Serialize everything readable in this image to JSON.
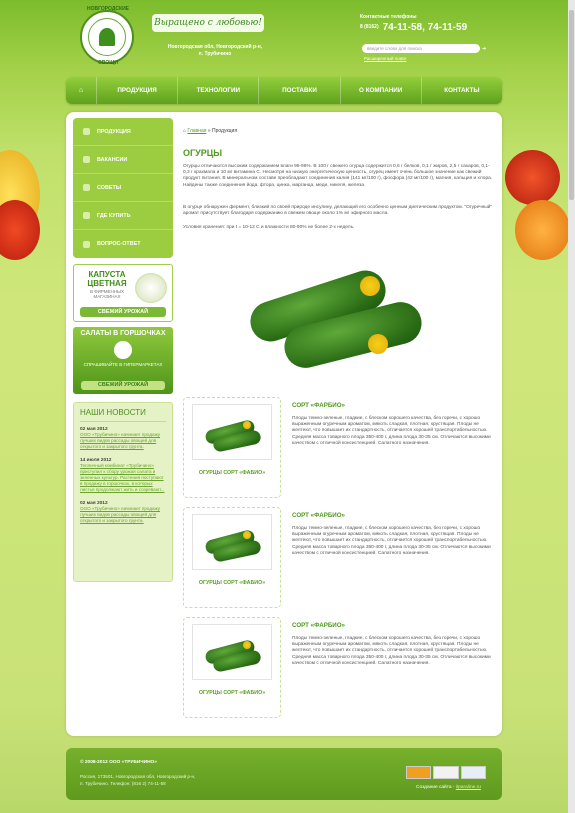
{
  "header": {
    "logo_top": "НОВГОРОДСКИЕ",
    "logo_bottom": "ОВОЩИ",
    "slogan": "Выращено с любовью!",
    "address_line1": "Новгородская обл, Новгородский р-н,",
    "address_line2": "п. Трубичино",
    "phones_label": "Контактные телефоны",
    "phone_code": "8 (8162)",
    "phones": "74-11-58, 74-11-59",
    "search_placeholder": "введите слово для поиска",
    "advanced_search": "Расширенный поиск"
  },
  "nav": {
    "home_icon": "home-icon",
    "items": [
      "ПРОДУКЦИЯ",
      "ТЕХНОЛОГИИ",
      "ПОСТАВКИ",
      "О КОМПАНИИ",
      "КОНТАКТЫ"
    ]
  },
  "sidebar": {
    "items": [
      "ПРОДУКЦИЯ",
      "ВАКАНСИИ",
      "СОВЕТЫ",
      "ГДЕ КУПИТЬ",
      "ВОПРОС-ОТВЕТ"
    ]
  },
  "banner1": {
    "title": "КАПУСТА ЦВЕТНАЯ",
    "sub": "В ФИРМЕННЫХ МАГАЗИНАХ",
    "bar": "СВЕЖИЙ УРОЖАЙ"
  },
  "banner2": {
    "title": "САЛАТЫ В ГОРШОЧКАХ",
    "sub": "СПРАШИВАЙТЕ В ГИПЕРМАРКЕТАХ",
    "bar": "СВЕЖИЙ УРОЖАЙ"
  },
  "news": {
    "title": "НАШИ НОВОСТИ",
    "items": [
      {
        "date": "02 мая 2012",
        "text": "ООО «Трубичино» начинает продажу лучших видов рассады овощей для открытого и закрытого грунта."
      },
      {
        "date": "14 июля 2012",
        "text": "Тепличный комбинат «Трубичино» приступил к сбору урожая салата и зеленных культур. Растения поступают в продажу в горшочках, в которых листья продолжают жить и созревают..."
      },
      {
        "date": "02 мая 2012",
        "text": "ООО «Трубичино» начинает продажу лучших видов рассады овощей для открытого и закрытого грунта."
      }
    ]
  },
  "breadcrumb": {
    "home": "Главная",
    "current": "Продукция"
  },
  "content": {
    "title": "ОГУРЦЫ",
    "p1": "Огурцы отличаются высоким содержанием влаги 95-96%. В 100 г свежего огурца содержится 0,6 г белков, 0,1 г жиров, 2,5 г сахаров, 0,1-0,3 г крахмала и 10 мг витамина С. Несмотря на низкую энергетическую ценность, огурец имеет очень большое значение как свежий продукт питания. В минеральном составе преобладают соединения калия (141 мг/100 г), фосфора (42 мг/100 г), магния, кальция и хлора. Найдены также соединения йода, фтора, цинка, марганца, меди, никеля, железа.",
    "p2": "В огурце обнаружен фермент, близкий по своей природе инсулину, делающий его особенно ценным диетическим продуктом. \"Огуречный\" аромат присутствует благодаря содержанию в свежем овоще около 1% мг эфирного масла.",
    "p3": "Условия хранения: при t = 10-12 С и влажности 80-90% не более 2-х недель."
  },
  "products": [
    {
      "caption": "ОГУРЦЫ СОРТ «ФАБИО»",
      "title": "СОРТ «ФАРБИО»",
      "desc": "Плоды темно-зеленые, гладкие, с блеском хорошего качества, без горечи, с хорошо выраженным огуречным ароматом, мякоть сладкая, плотная, хрустящая. Плоды не желтеют, что повышает их стандартность, отличается хорошей транспортабельностью. Средняя масса товарного плода 350-400 г, длина плода 30-35 см. Отличаются высокими качеством с отличной консистенцией. Салатного назначения."
    },
    {
      "caption": "ОГУРЦЫ СОРТ «ФАБИО»",
      "title": "СОРТ «ФАРБИО»",
      "desc": "Плоды темно-зеленые, гладкие, с блеском хорошего качества, без горечи, с хорошо выраженным огуречным ароматом, мякоть сладкая, плотная, хрустящая. Плоды не желтеют, что повышает их стандартность, отличается хорошей транспортабельностью. Средняя масса товарного плода 350-400 г, длина плода 30-35 см. Отличаются высокими качеством с отличной консистенцией. Салатного назначения."
    },
    {
      "caption": "ОГУРЦЫ СОРТ «ФАБИО»",
      "title": "СОРТ «ФАРБИО»",
      "desc": "Плоды темно-зеленые, гладкие, с блеском хорошего качества, без горечи, с хорошо выраженным огуречным ароматом, мякоть сладкая, плотная, хрустящая. Плоды не желтеют, что повышает их стандартность, отличается хорошей транспортабельностью. Средняя масса товарного плода 350-400 г, длина плода 30-35 см. Отличаются высокими качеством с отличной консистенцией. Салатного назначения."
    }
  ],
  "footer": {
    "copyright": "© 2008-2012 ООО «ТРУБИЧИНО»",
    "address1": "Россия, 173501, Новгородская обл, Новгородский р-н,",
    "address2": "п. Трубичино. Телефон: (816 2) 74-11-58",
    "created_label": "Создание сайта -",
    "created_link": "itparaline.ru"
  },
  "colors": {
    "accent": "#5aa02c",
    "nav": "#6fb12a",
    "bg": "#bfe06a"
  }
}
